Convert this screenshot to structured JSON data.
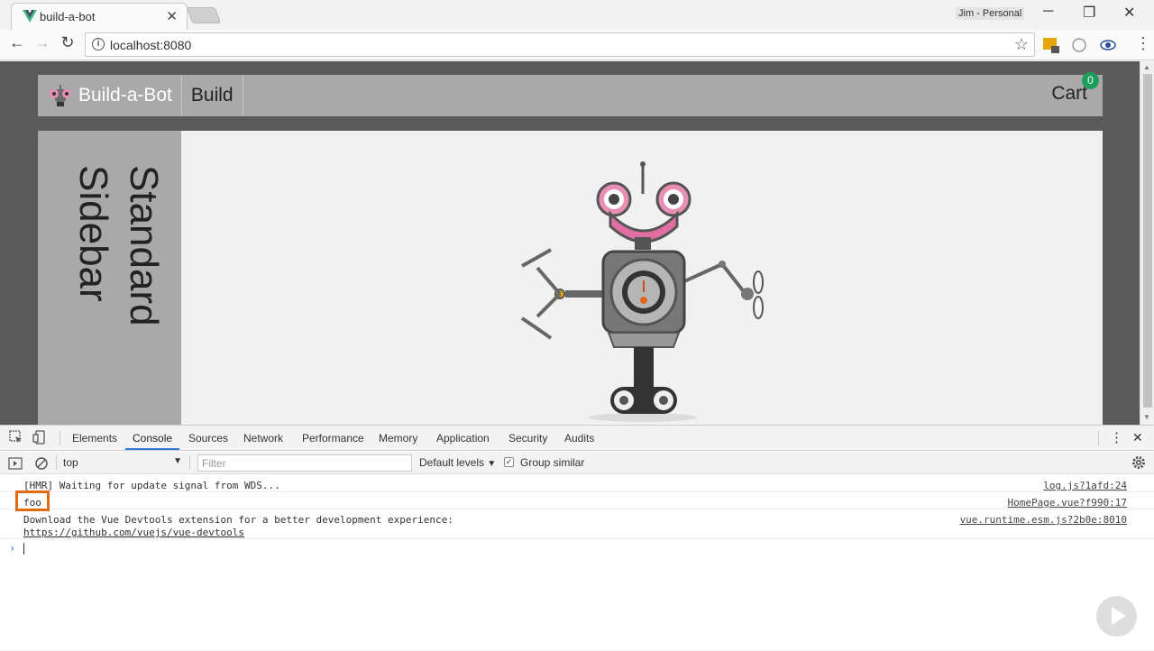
{
  "browser": {
    "tab": {
      "title": "build-a-bot",
      "close": "✕"
    },
    "profile": "Jim - Personal",
    "window_controls": {
      "minimize": "─",
      "restore": "❐",
      "close": "✕"
    },
    "url": "localhost:8080",
    "accent": "#3879d9"
  },
  "app": {
    "logo_text": "Build-a-Bot",
    "nav_build": "Build",
    "cart_label": "Cart",
    "cart_count": "0",
    "sidebar_text": "Standard\nSidebar",
    "colors": {
      "nav_bg": "#a9a9a9",
      "badge": "#1e9e5c",
      "page_bg": "#5a5a5a"
    }
  },
  "devtools": {
    "tabs": [
      "Elements",
      "Console",
      "Sources",
      "Network",
      "Performance",
      "Memory",
      "Application",
      "Security",
      "Audits"
    ],
    "active_tab": "Console",
    "context": "top",
    "filter_placeholder": "Filter",
    "levels": "Default levels",
    "group_similar": "Group similar",
    "messages": [
      {
        "text": "[HMR] Waiting for update signal from WDS...",
        "source": "log.js?1afd:24"
      },
      {
        "text": "foo",
        "source": "HomePage.vue?f990:17"
      },
      {
        "text": "Download the Vue Devtools extension for a better development experience:",
        "link": "https://github.com/vuejs/vue-devtools",
        "source": "vue.runtime.esm.js?2b0e:8010"
      }
    ]
  }
}
